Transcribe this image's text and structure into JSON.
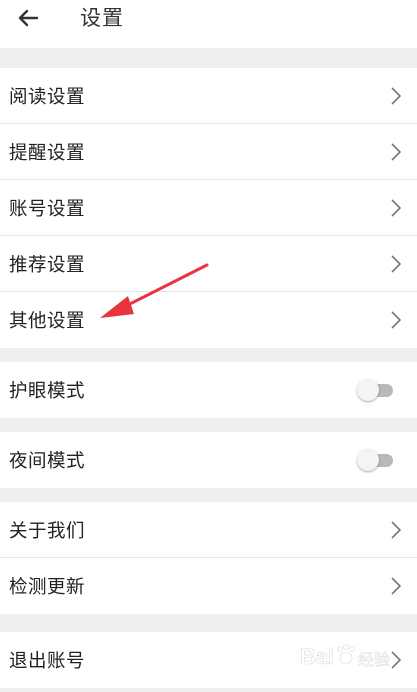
{
  "header": {
    "title": "设置"
  },
  "groups": [
    {
      "items": [
        {
          "label": "阅读设置"
        },
        {
          "label": "提醒设置"
        },
        {
          "label": "账号设置"
        },
        {
          "label": "推荐设置"
        },
        {
          "label": "其他设置"
        }
      ]
    },
    {
      "items": [
        {
          "label": "护眼模式",
          "toggle_on": false
        }
      ]
    },
    {
      "items": [
        {
          "label": "夜间模式",
          "toggle_on": false
        }
      ]
    },
    {
      "items": [
        {
          "label": "关于我们"
        },
        {
          "label": "检测更新"
        }
      ]
    },
    {
      "items": [
        {
          "label": "退出账号"
        }
      ]
    }
  ],
  "colors": {
    "background": "#efeff1",
    "annotation_arrow": "#e8343c",
    "toggle_off_track": "#b9b9b9"
  },
  "icons": {
    "back": "arrow-left-icon",
    "row_chevron": "chevron-right-icon"
  },
  "watermark": {
    "text": "Bai 经验"
  }
}
